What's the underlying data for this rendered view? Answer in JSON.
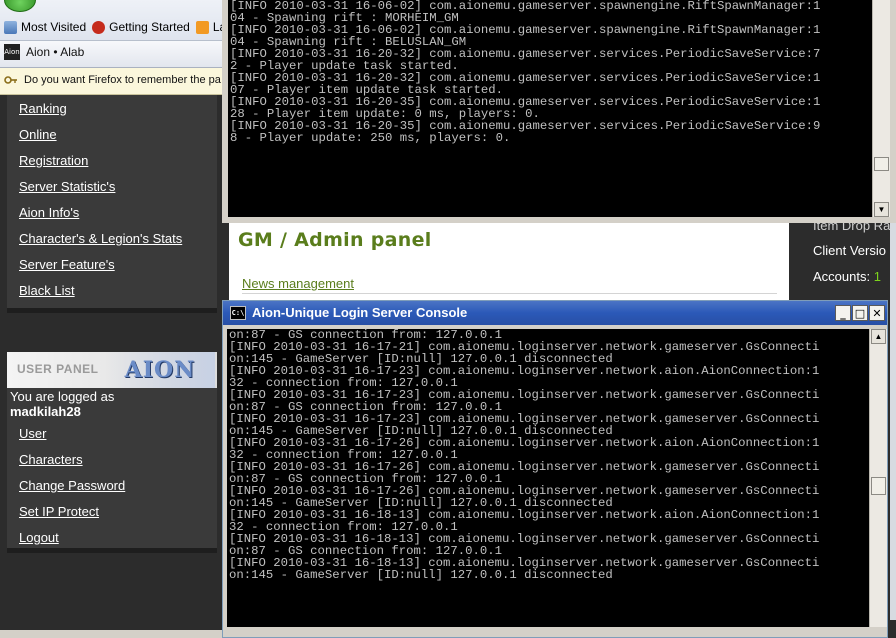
{
  "browser": {
    "bookmarks": [
      "Most Visited",
      "Getting Started",
      "Lat"
    ],
    "tab_title": "Aion • Alab",
    "favicon_text": "Aion",
    "notification": "Do you want Firefox to remember the pa"
  },
  "sidebar": {
    "nav_links": [
      "Ranking",
      "Online",
      "Registration",
      "Server Statistic's",
      "Aion Info's",
      "Character's & Legion's Stats",
      "Server Feature's",
      "Black List"
    ],
    "user_panel_title": "USER PANEL",
    "logo_text": "AION",
    "logged_label": "You are logged as",
    "logged_user": "madkilah28",
    "user_links": [
      "User",
      "Characters",
      "Change Password",
      "Set IP Protect",
      "Logout"
    ]
  },
  "page": {
    "title": "GM / Admin panel",
    "news_link": "News management"
  },
  "right_panel": {
    "line1": "Item Drop Ra",
    "line2": "Client Versio",
    "line3_label": "Accounts: ",
    "line3_value": "1"
  },
  "game_console": {
    "lines": [
      "[INFO 2010-03-31 16-06-02] com.aionemu.gameserver.spawnengine.RiftSpawnManager:1",
      "04 - Spawning rift : MORHEIM_GM",
      "[INFO 2010-03-31 16-06-02] com.aionemu.gameserver.spawnengine.RiftSpawnManager:1",
      "04 - Spawning rift : BELUSLAN_GM",
      "[INFO 2010-03-31 16-20-32] com.aionemu.gameserver.services.PeriodicSaveService:7",
      "2 - Player update task started.",
      "[INFO 2010-03-31 16-20-32] com.aionemu.gameserver.services.PeriodicSaveService:1",
      "07 - Player item update task started.",
      "[INFO 2010-03-31 16-20-35] com.aionemu.gameserver.services.PeriodicSaveService:1",
      "28 - Player item update: 0 ms, players: 0.",
      "[INFO 2010-03-31 16-20-35] com.aionemu.gameserver.services.PeriodicSaveService:9",
      "8 - Player update: 250 ms, players: 0."
    ]
  },
  "login_console": {
    "title": "Aion-Unique Login Server Console",
    "icon_text": "C:\\",
    "controls": {
      "minimize": "_",
      "maximize": "□",
      "close": "✕"
    },
    "lines": [
      "on:87 - GS connection from: 127.0.0.1",
      "[INFO 2010-03-31 16-17-21] com.aionemu.loginserver.network.gameserver.GsConnecti",
      "on:145 - GameServer [ID:null] 127.0.0.1 disconnected",
      "[INFO 2010-03-31 16-17-23] com.aionemu.loginserver.network.aion.AionConnection:1",
      "32 - connection from: 127.0.0.1",
      "[INFO 2010-03-31 16-17-23] com.aionemu.loginserver.network.gameserver.GsConnecti",
      "on:87 - GS connection from: 127.0.0.1",
      "[INFO 2010-03-31 16-17-23] com.aionemu.loginserver.network.gameserver.GsConnecti",
      "on:145 - GameServer [ID:null] 127.0.0.1 disconnected",
      "[INFO 2010-03-31 16-17-26] com.aionemu.loginserver.network.aion.AionConnection:1",
      "32 - connection from: 127.0.0.1",
      "[INFO 2010-03-31 16-17-26] com.aionemu.loginserver.network.gameserver.GsConnecti",
      "on:87 - GS connection from: 127.0.0.1",
      "[INFO 2010-03-31 16-17-26] com.aionemu.loginserver.network.gameserver.GsConnecti",
      "on:145 - GameServer [ID:null] 127.0.0.1 disconnected",
      "[INFO 2010-03-31 16-18-13] com.aionemu.loginserver.network.aion.AionConnection:1",
      "32 - connection from: 127.0.0.1",
      "[INFO 2010-03-31 16-18-13] com.aionemu.loginserver.network.gameserver.GsConnecti",
      "on:87 - GS connection from: 127.0.0.1",
      "[INFO 2010-03-31 16-18-13] com.aionemu.loginserver.network.gameserver.GsConnecti",
      "on:145 - GameServer [ID:null] 127.0.0.1 disconnected"
    ]
  },
  "colors": {
    "sidebar_bg": "#2c2c2c",
    "accent_green": "#5a7d1c",
    "titlebar_blue": "#2b59b8",
    "console_text": "#c0c0c0"
  }
}
